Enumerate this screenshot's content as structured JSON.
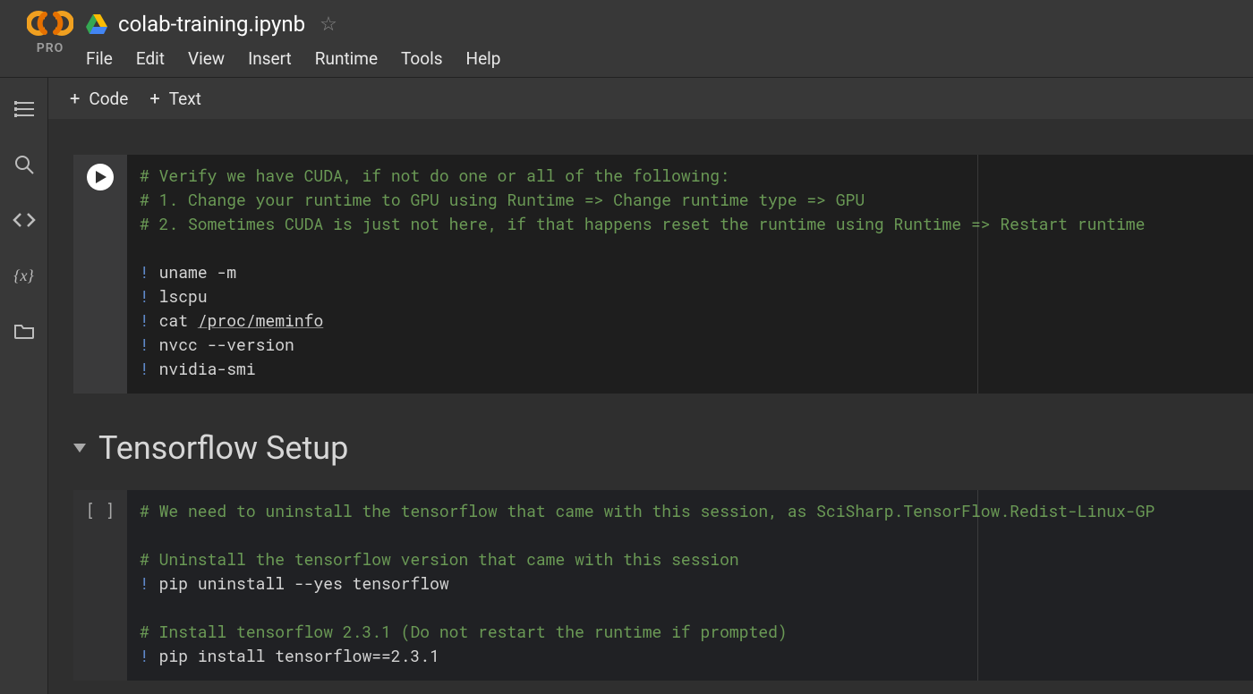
{
  "header": {
    "logo_sub": "PRO",
    "title": "colab-training.ipynb"
  },
  "menubar": {
    "file": "File",
    "edit": "Edit",
    "view": "View",
    "insert": "Insert",
    "runtime": "Runtime",
    "tools": "Tools",
    "help": "Help"
  },
  "toolbar": {
    "code": "Code",
    "text": "Text"
  },
  "cells": {
    "cell1": {
      "l1": "# Verify we have CUDA, if not do one or all of the following:",
      "l2": "# 1. Change your runtime to GPU using Runtime => Change runtime type => GPU",
      "l3": "# 2. Sometimes CUDA is just not here, if that happens reset the runtime using Runtime => Restart runtime ",
      "bang": "!",
      "c1": " uname -m",
      "c2": " lscpu",
      "c3a": " cat ",
      "c3b": "/proc/meminfo",
      "c4": " nvcc --version",
      "c5": " nvidia-smi"
    },
    "heading": "Tensorflow Setup",
    "cell2": {
      "exec": "[ ]",
      "l1": "# We need to uninstall the tensorflow that came with this session, as SciSharp.TensorFlow.Redist-Linux-GP",
      "l2": "# Uninstall the tensorflow version that came with this session",
      "bang": "!",
      "c1": " pip uninstall --yes tensorflow",
      "l3": "# Install tensorflow 2.3.1 (Do not restart the runtime if prompted)",
      "c2": " pip install tensorflow==2.3.1"
    }
  },
  "sidebar": {
    "varx": "{x}"
  }
}
